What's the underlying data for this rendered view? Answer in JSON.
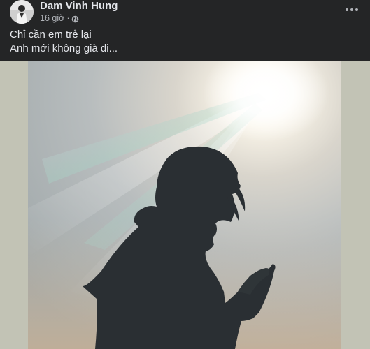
{
  "post": {
    "author": "Dam Vinh Hung",
    "timestamp": "16 giờ",
    "separator": "·",
    "privacy_icon": "globe-icon",
    "more_icon": "more-horizontal-icon",
    "caption_lines": [
      "Chỉ cần em trẻ lại",
      "Anh mới không già đi..."
    ]
  },
  "colors": {
    "background": "#242526",
    "text_primary": "#e4e6eb",
    "text_secondary": "#b0b3b8",
    "photo_side_padding": "#c2c3b5"
  }
}
